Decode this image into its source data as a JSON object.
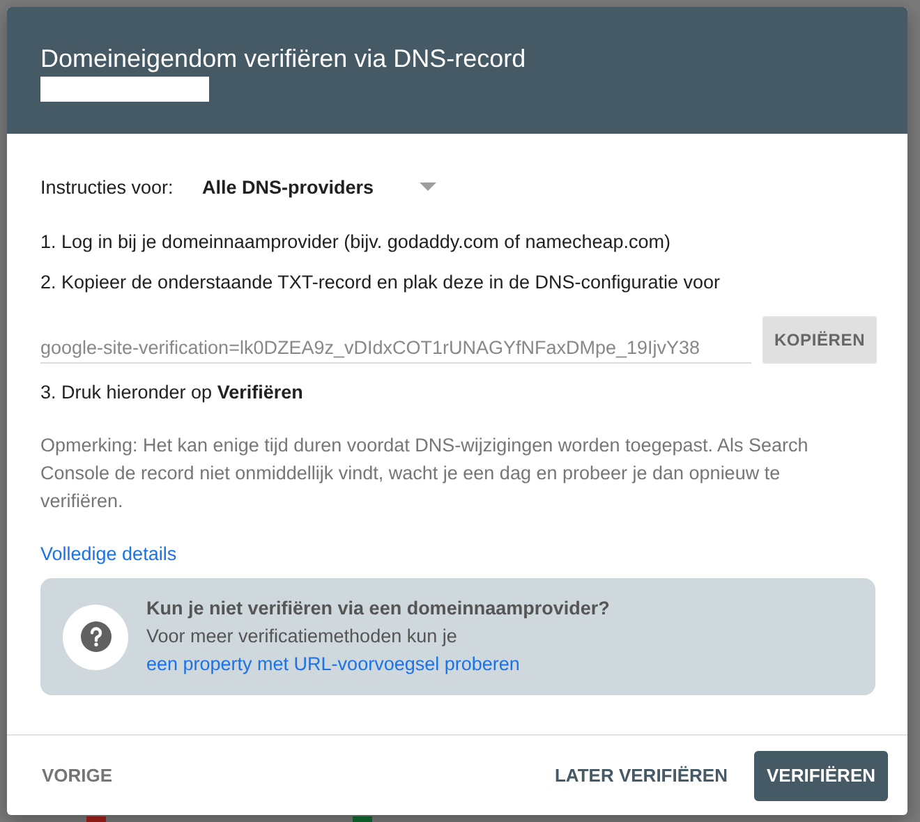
{
  "background": {
    "legend": [
      {
        "color": "#8a1a16"
      },
      {
        "color": "#0f5a29"
      }
    ]
  },
  "dialog": {
    "title": "Domeineigendom verifiëren via DNS-record",
    "instructions": {
      "label": "Instructies voor:",
      "value": "Alle DNS-providers"
    },
    "steps": [
      "1. Log in bij je domeinnaamprovider (bijv. godaddy.com of namecheap.com)",
      "2. Kopieer de onderstaande TXT-record en plak deze in de DNS-configuratie voor"
    ],
    "record": {
      "value": "google-site-verification=lk0DZEA9z_vDIdxCOT1rUNAGYfNFaxDMpe_19IjvY38",
      "button": "KOPIËREN"
    },
    "step3": "3. Druk hieronder op **Verifiëren**",
    "note": "Opmerking: Het kan enige tijd duren voordat DNS-wijzigingen worden toegepast. Als Search Console de record niet onmiddellijk vindt, wacht je een dag en probeer je dan opnieuw te verifiëren.",
    "details_link": "Volledige details",
    "info": {
      "title": "Kun je niet verifiëren via een domeinnaamprovider?",
      "text": "Voor meer verificatiemethoden kun je",
      "link": "een property met URL-voorvoegsel proberen"
    },
    "footer": {
      "back": "VORIGE",
      "later": "LATER VERIFIËREN",
      "verify": "VERIFIËREN"
    }
  }
}
